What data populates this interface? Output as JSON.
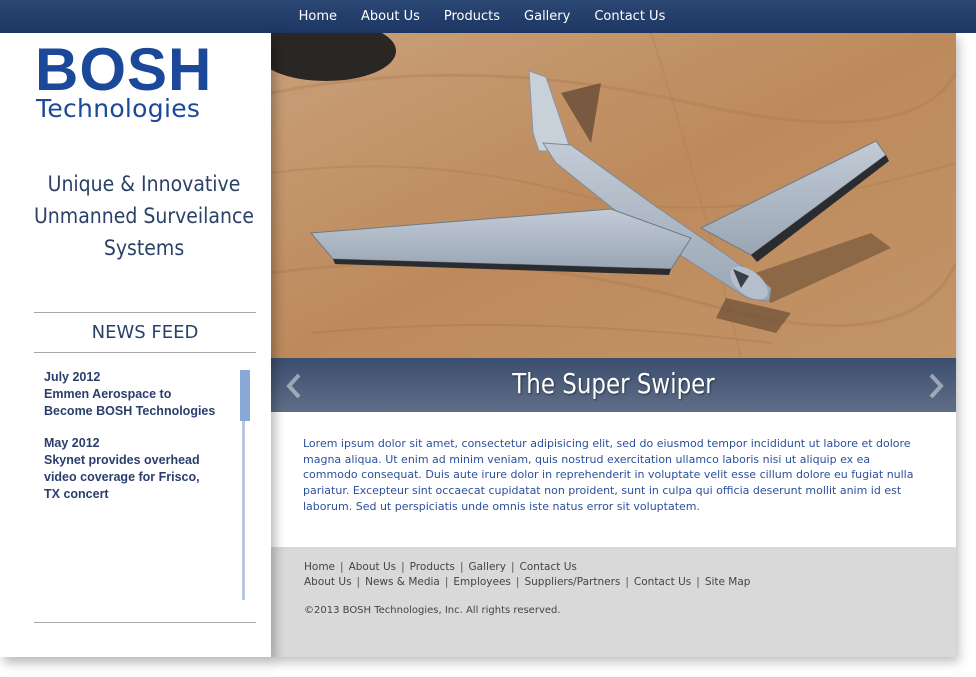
{
  "nav": {
    "items": [
      "Home",
      "About Us",
      "Products",
      "Gallery",
      "Contact Us"
    ]
  },
  "logo": {
    "main": "BOSH",
    "sub": "Technologies"
  },
  "tagline": {
    "line1": "Unique & Innovative",
    "line2": "Unmanned Surveilance",
    "line3": "Systems"
  },
  "news": {
    "title": "NEWS FEED",
    "items": [
      {
        "date": "July 2012",
        "line1": "Emmen Aerospace to",
        "line2": "Become BOSH Technologies",
        "line3": ""
      },
      {
        "date": "May 2012",
        "line1": "Skynet provides overhead",
        "line2": "video coverage for Frisco,",
        "line3": "TX concert"
      }
    ]
  },
  "slider": {
    "caption": "The Super Swiper",
    "prev_icon": "chevron-left-icon",
    "next_icon": "chevron-right-icon"
  },
  "content": {
    "paragraph": "Lorem ipsum dolor sit amet, consectetur adipisicing elit, sed do eiusmod tempor incididunt ut labore et dolore magna aliqua. Ut enim ad minim veniam, quis nostrud exercitation ullamco laboris nisi ut aliquip ex ea commodo consequat. Duis aute irure dolor in reprehenderit in voluptate velit esse cillum dolore eu fugiat nulla pariatur. Excepteur sint occaecat cupidatat non proident, sunt in culpa qui officia deserunt mollit anim id est laborum. Sed ut perspiciatis unde omnis iste natus error sit voluptatem."
  },
  "footer": {
    "row1": [
      "Home",
      "About Us",
      "Products",
      "Gallery",
      "Contact Us"
    ],
    "row2": [
      "About Us",
      "News & Media",
      "Employees",
      "Suppliers/Partners",
      "Contact Us",
      "Site Map"
    ],
    "copyright": "©2013 BOSH Technologies, Inc. All rights reserved."
  },
  "colors": {
    "nav_bg": "#1e3764",
    "brand_blue": "#1c4899",
    "text_blue": "#2c4f9c",
    "footer_bg": "#d9d9d9"
  }
}
